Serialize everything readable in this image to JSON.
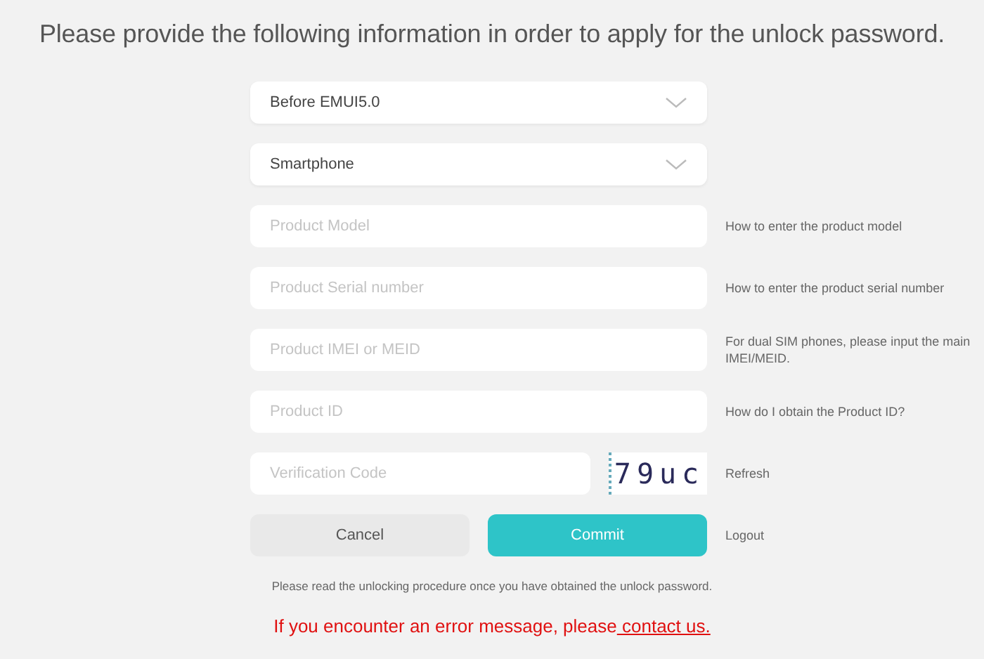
{
  "heading": "Please provide the following information in order to apply for the unlock password.",
  "rows": [
    {
      "kind": "select",
      "value": "Before EMUI5.0"
    },
    {
      "kind": "select",
      "value": "Smartphone"
    },
    {
      "kind": "input",
      "placeholder": "Product Model",
      "hint": "How to enter the product model"
    },
    {
      "kind": "input",
      "placeholder": "Product Serial number",
      "hint": "How to enter the product serial number"
    },
    {
      "kind": "input",
      "placeholder": "Product IMEI or MEID",
      "hint": "For dual SIM phones, please input the main IMEI/MEID."
    },
    {
      "kind": "input",
      "placeholder": "Product ID",
      "hint": "How do I obtain the Product ID?"
    },
    {
      "kind": "captcha",
      "placeholder": "Verification Code",
      "code": "79uc",
      "hint": "Refresh"
    }
  ],
  "buttons": {
    "cancel": "Cancel",
    "commit": "Commit",
    "logout": "Logout"
  },
  "note": "Please read the unlocking procedure once you have obtained the unlock password.",
  "error": {
    "text": "If you encounter an error message, please",
    "link": "contact us."
  }
}
